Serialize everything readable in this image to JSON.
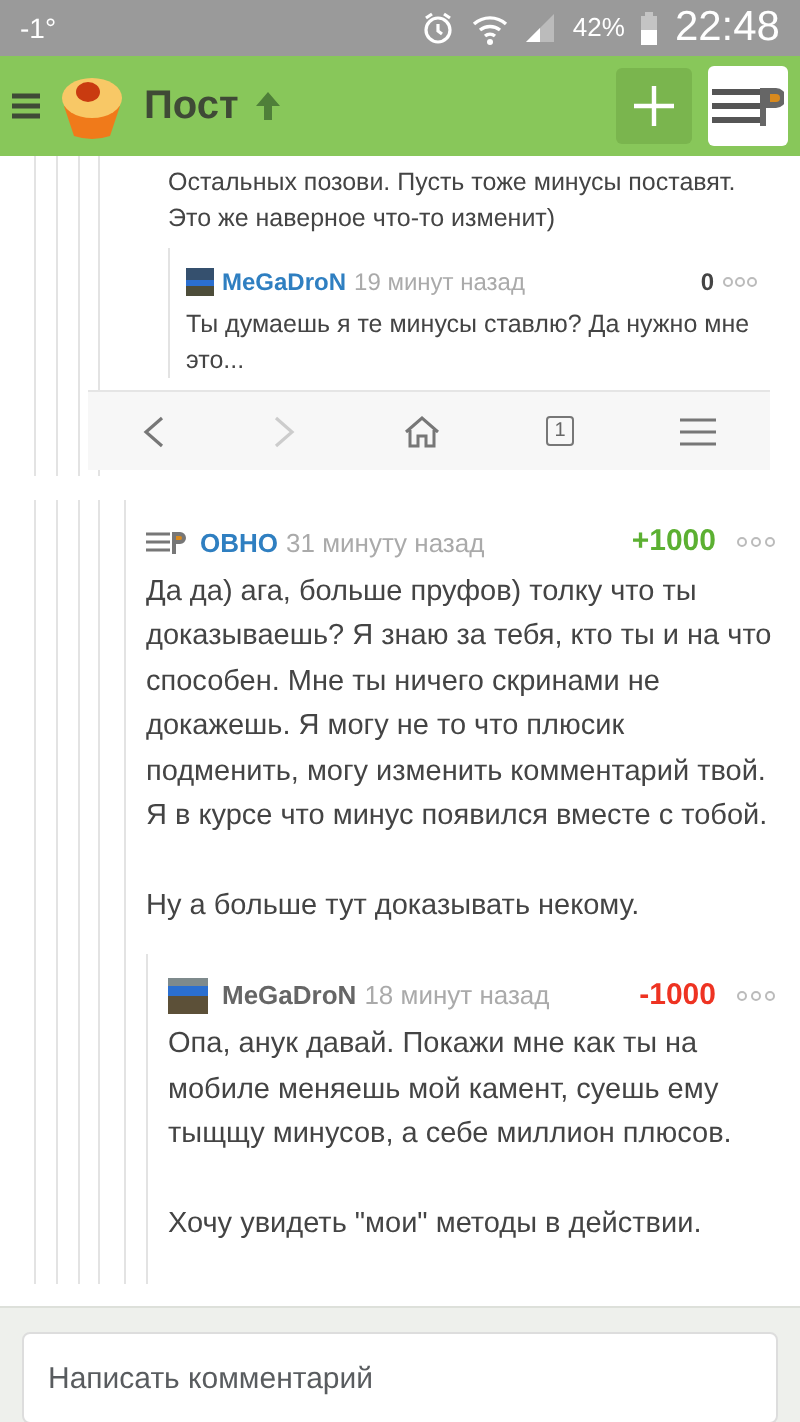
{
  "status_bar": {
    "temperature": "-1°",
    "battery": "42%",
    "time": "22:48"
  },
  "header": {
    "title": "Пост"
  },
  "screenshot": {
    "lines": [
      "Остальных позови. Пусть тоже минусы поставят.",
      "Это же наверное что-то изменит)"
    ],
    "reply": {
      "author": "MeGaDroN",
      "time": "19 минут назад",
      "score": "0",
      "text": "Ты думаешь я те минусы ставлю? Да нужно мне это..."
    },
    "tab_count": "1"
  },
  "comments": [
    {
      "kind": "logo",
      "author": {
        "name": "ОВНО",
        "color": "#2f7fc1"
      },
      "time": "31 минуту назад",
      "score": {
        "text": "+1000",
        "color": "#5cb032"
      },
      "paragraphs": [
        "Да да) ага, больше пруфов) толку что ты доказываешь? Я знаю за тебя, кто ты и на что способен. Мне ты ничего скринами не докажешь. Я могу не то что плюсик подменить, могу изменить комментарий твой. Я в курсе что минус появился вместе с тобой.",
        "Ну а больше тут доказывать некому."
      ],
      "children": [
        {
          "kind": "picture",
          "author": {
            "name": "MeGaDroN",
            "color": "#666666"
          },
          "time": "18 минут назад",
          "score": {
            "text": "-1000",
            "color": "#ee3322"
          },
          "paragraphs": [
            "Опа, анук давай. Покажи мне как ты на мобиле меняешь мой камент, суешь ему тыщщу минусов, а себе миллион плюсов.",
            "Хочу увидеть \"мои\" методы в действии."
          ]
        }
      ]
    }
  ],
  "comment_field": {
    "placeholder": "Написать комментарий"
  }
}
